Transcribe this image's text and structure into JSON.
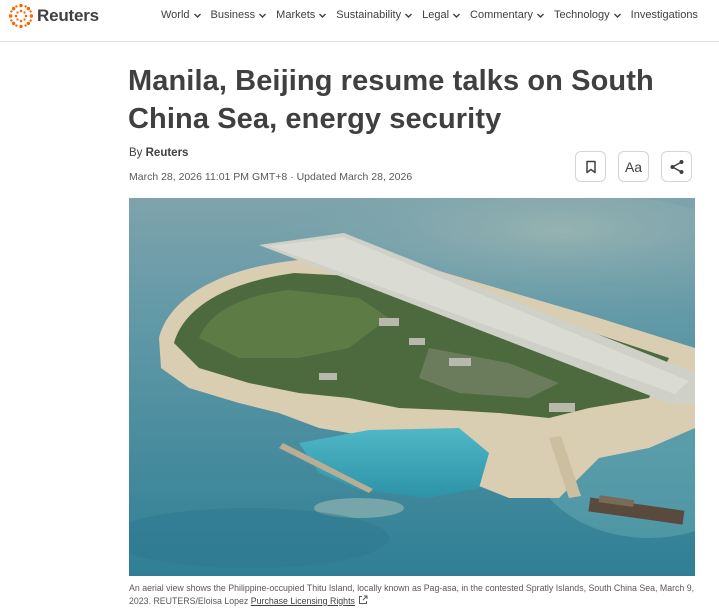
{
  "header": {
    "brand": "Reuters",
    "brand_color": "#fa6400",
    "nav": [
      {
        "label": "World",
        "icon": "chevron-down-icon"
      },
      {
        "label": "Business",
        "icon": "chevron-down-icon"
      },
      {
        "label": "Markets",
        "icon": "chevron-down-icon"
      },
      {
        "label": "Sustainability",
        "icon": "chevron-down-icon"
      },
      {
        "label": "Legal",
        "icon": "chevron-down-icon"
      },
      {
        "label": "Commentary",
        "icon": "chevron-down-icon"
      },
      {
        "label": "Technology",
        "icon": "chevron-down-icon"
      },
      {
        "label": "Investigations",
        "icon": null
      }
    ]
  },
  "article": {
    "headline_line1": "Manila, Beijing resume talks on South",
    "headline_line2": "China Sea, energy security",
    "byline_prefix": "By",
    "author": "Reuters",
    "dateline": "March 28, 2026 11:01 PM GMT+8 · Updated March 28, 2026",
    "actions": [
      {
        "name": "bookmark-button",
        "icon": "bookmark-icon"
      },
      {
        "name": "text-size-button",
        "icon": "text-size-icon",
        "label": "Aa"
      },
      {
        "name": "share-button",
        "icon": "share-icon"
      }
    ],
    "image": {
      "subject": "aerial-island-photo"
    },
    "caption": "An aerial view shows the Philippine-occupied Thitu Island, locally known as Pag-asa, in the contested Spratly Islands, South China Sea, March 9, 2023. REUTERS/Eloisa Lopez",
    "license_link": "Purchase Licensing Rights",
    "license_icon": "external-link-icon"
  }
}
